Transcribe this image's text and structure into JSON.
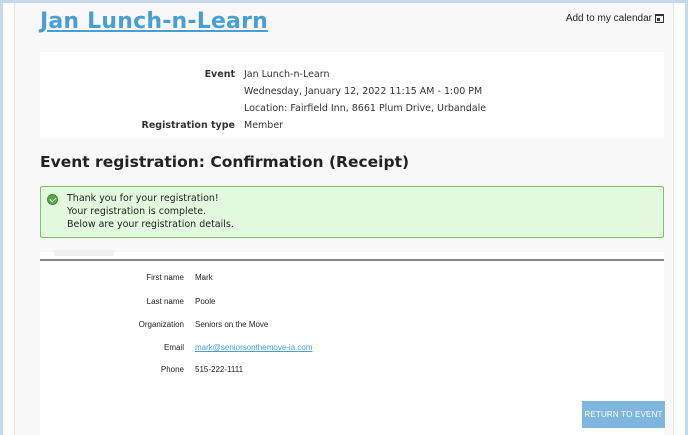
{
  "header": {
    "title": "Jan Lunch-n-Learn",
    "add_calendar": "Add to my calendar"
  },
  "event": {
    "event_label": "Event",
    "event_name": "Jan Lunch-n-Learn",
    "event_datetime": "Wednesday, January 12, 2022 11:15 AM - 1:00 PM",
    "event_location": "Location: Fairfield Inn, 8661 Plum Drive, Urbandale",
    "registration_type_label": "Registration type",
    "registration_type": "Member"
  },
  "confirmation": {
    "section_title": "Event registration: Confirmation (Receipt)",
    "message_lines": [
      "Thank you for your registration!",
      "Your registration is complete.",
      "Below are your registration details."
    ]
  },
  "details": {
    "fields": [
      {
        "label": "First name",
        "value": "Mark"
      },
      {
        "label": "Last name",
        "value": "Poole"
      },
      {
        "label": "Organization",
        "value": "Seniors on the Move"
      },
      {
        "label": "Email",
        "value": "mark@seniorsonthemove-ia.com"
      },
      {
        "label": "Phone",
        "value": "515-222-1111"
      }
    ],
    "return_button": "RETURN TO EVENT"
  },
  "colors": {
    "link": "#4a9fd2",
    "success_bg": "#e3f9dd",
    "success_border": "#7dc070",
    "button_bg": "#7fb6de"
  }
}
